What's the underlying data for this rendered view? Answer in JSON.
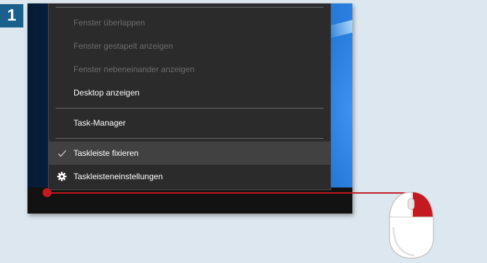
{
  "step": {
    "number": "1"
  },
  "menu": {
    "items": [
      {
        "label": "Fenster überlappen",
        "enabled": false
      },
      {
        "label": "Fenster gestapelt anzeigen",
        "enabled": false
      },
      {
        "label": "Fenster nebeneinander anzeigen",
        "enabled": false
      },
      {
        "label": "Desktop anzeigen",
        "enabled": true
      },
      {
        "label": "Task-Manager",
        "enabled": true
      },
      {
        "label": "Taskleiste fixieren",
        "enabled": true,
        "checked": true,
        "icon": "checkmark-icon"
      },
      {
        "label": "Taskleisteneinstellungen",
        "enabled": true,
        "icon": "gear-icon"
      }
    ]
  },
  "colors": {
    "accent_red": "#c41920",
    "badge_blue": "#1b5f8c",
    "menu_bg": "#2b2b2b",
    "menu_hover": "#414141",
    "disabled_text": "#6d6d6d"
  }
}
